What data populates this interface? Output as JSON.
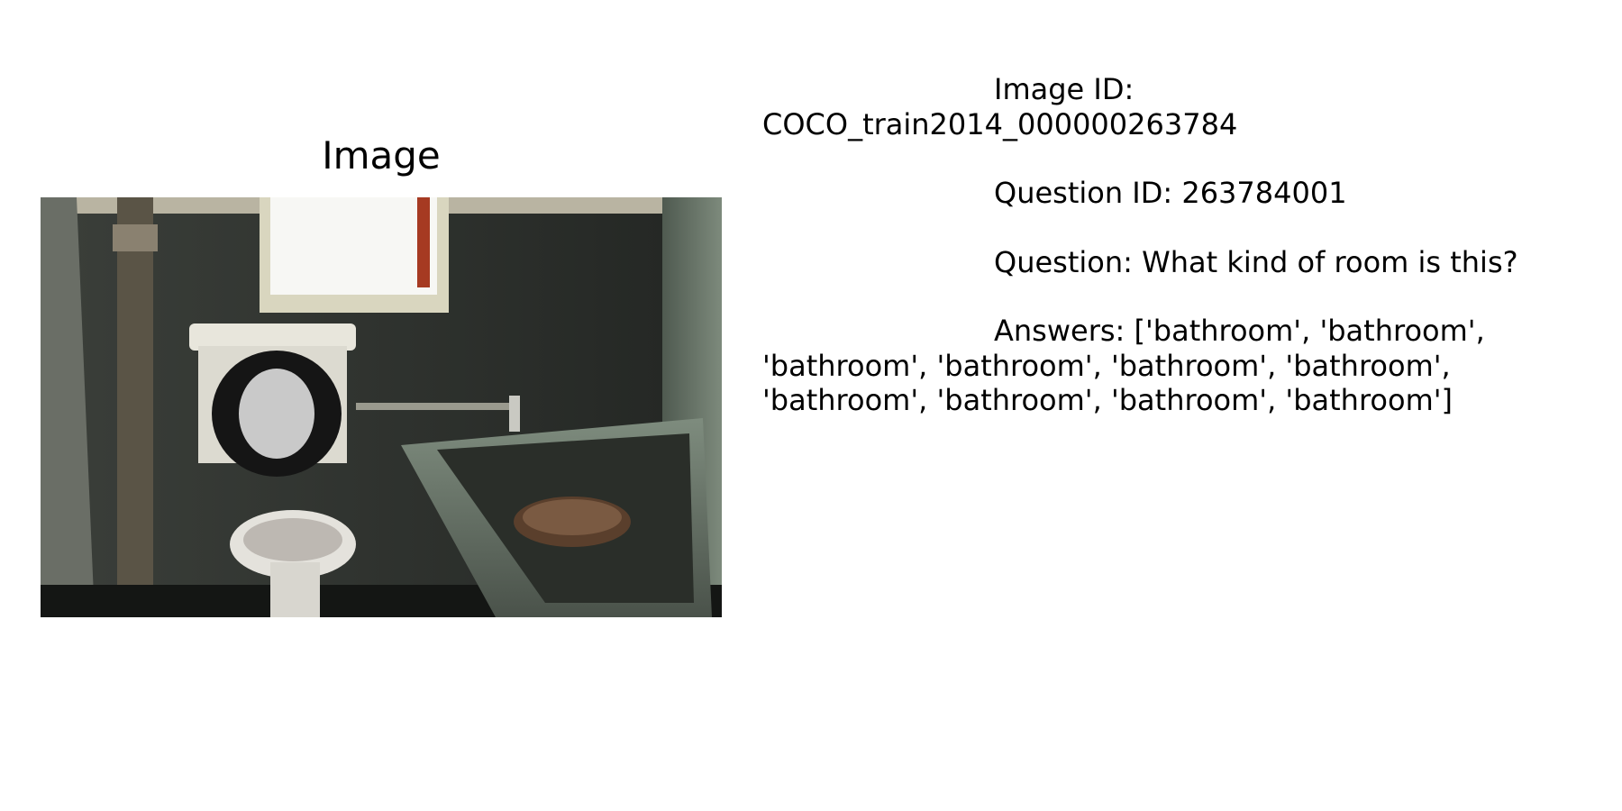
{
  "panel": {
    "title": "Image"
  },
  "info": {
    "image_id_label": "Image ID:",
    "image_id_value": "COCO_train2014_000000263784",
    "question_id": "Question ID: 263784001",
    "question": "Question: What kind of room is this?",
    "answers": "Answers: ['bathroom', 'bathroom', 'bathroom', 'bathroom', 'bathroom', 'bathroom', 'bathroom', 'bathroom', 'bathroom', 'bathroom']"
  }
}
